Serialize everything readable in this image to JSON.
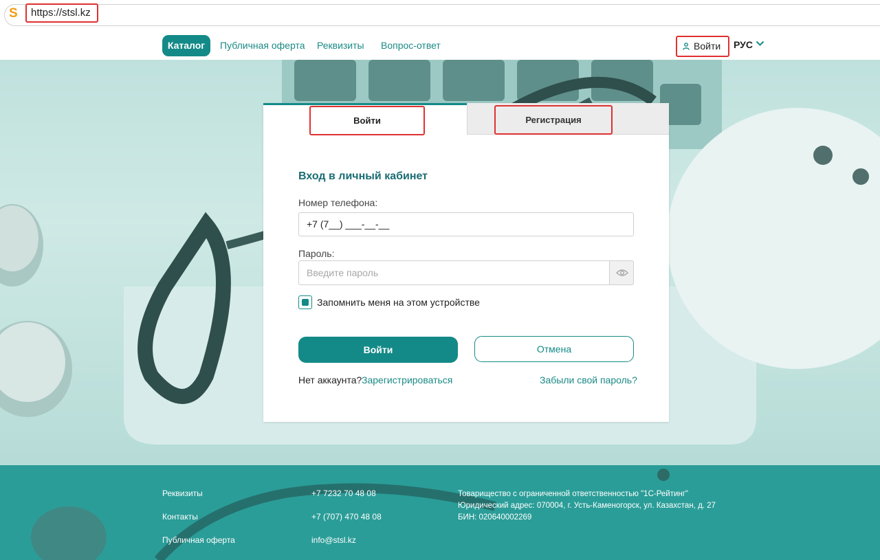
{
  "browser": {
    "url": "https://stsl.kz"
  },
  "nav": {
    "catalog": "Каталог",
    "links": [
      "Публичная оферта",
      "Реквизиты",
      "Вопрос-ответ"
    ],
    "login": "Войти",
    "language": "РУС"
  },
  "card": {
    "tabs": {
      "login": "Войти",
      "register": "Регистрация"
    },
    "title": "Вход в личный кабинет",
    "phone_label": "Номер телефона:",
    "phone_value": "+7 (7__) ___-__-__",
    "password_label": "Пароль:",
    "password_placeholder": "Введите пароль",
    "remember_label": "Запомнить меня на этом устройстве",
    "remember_checked": true,
    "login_button": "Войти",
    "cancel_button": "Отмена",
    "no_account": "Нет аккаунта?",
    "register_link": "Зарегистрироваться",
    "forgot_link": "Забыли свой пароль?"
  },
  "footer": {
    "links": [
      "Реквизиты",
      "Контакты",
      "Публичная оферта"
    ],
    "contacts": [
      "+7 7232 70 48 08",
      "+7 (707) 470 48 08",
      "info@stsl.kz"
    ],
    "company": [
      "Товарищество с ограниченной ответственностью \"1С-Рейтинг\"",
      "Юридический адрес: 070004, г. Усть-Каменогорск, ул. Казахстан, д. 27",
      "БИН: 020640002269"
    ]
  },
  "colors": {
    "accent": "#138a87",
    "highlight": "#e03030",
    "footer": "#2b9d98"
  }
}
